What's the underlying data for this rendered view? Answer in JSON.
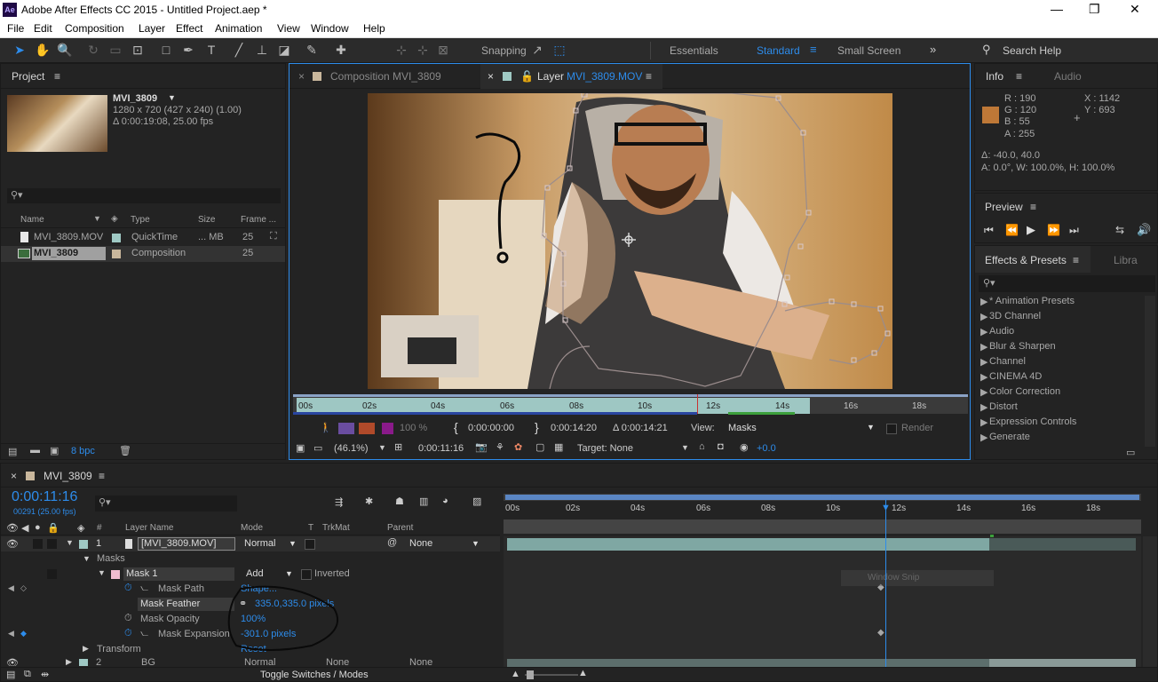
{
  "window": {
    "title": "Adobe After Effects CC 2015 - Untitled Project.aep *",
    "logo": "Ae",
    "minimize": "—",
    "maximize": "❐",
    "close": "✕"
  },
  "menu": [
    "File",
    "Edit",
    "Composition",
    "Layer",
    "Effect",
    "Animation",
    "View",
    "Window",
    "Help"
  ],
  "toolbar": {
    "snapping_label": "Snapping",
    "workspaces": [
      "Essentials",
      "Standard",
      "Small Screen"
    ],
    "active_workspace": "Standard",
    "search_help": "Search Help"
  },
  "project": {
    "tab": "Project",
    "item_name": "MVI_3809",
    "item_dims": "1280 x 720  (427 x 240) (1.00)",
    "item_duration": "Δ 0:00:19:08, 25.00 fps",
    "columns": [
      "Name",
      "Type",
      "Size",
      "Frame ..."
    ],
    "rows": [
      {
        "name": "MVI_3809.MOV",
        "type": "QuickTime",
        "size": "... MB",
        "frame": "25"
      },
      {
        "name": "MVI_3809",
        "type": "Composition",
        "size": "",
        "frame": "25"
      }
    ],
    "bpc": "8 bpc"
  },
  "viewer": {
    "tab_comp": "Composition MVI_3809",
    "tab_layer_prefix": "Layer",
    "tab_layer_name": "MVI_3809.MOV",
    "ruler": [
      "00s",
      "02s",
      "04s",
      "06s",
      "08s",
      "10s",
      "12s",
      "14s",
      "16s",
      "18s"
    ],
    "in_time": "0:00:00:00",
    "out_time": "0:00:14:20",
    "dur_time": "Δ 0:00:14:21",
    "view_label": "View:",
    "view_value": "Masks",
    "render_label": "Render",
    "zoom": "(46.1%)",
    "current_time": "0:00:11:16",
    "target": "Target: None",
    "exposure": "+0.0",
    "opacity_pct": "100 %"
  },
  "info": {
    "tab": "Info",
    "tab2": "Audio",
    "r": "R :  190",
    "g": "G :  120",
    "b": "B :  55",
    "a": "A :  255",
    "x": "X : 1142",
    "y": "Y : 693",
    "delta": "Δ: -40.0, 40.0",
    "line2": "A: 0.0°, W: 100.0%, H: 100.0%",
    "color_hex": "#be7837"
  },
  "preview": {
    "tab": "Preview"
  },
  "effects": {
    "tab": "Effects & Presets",
    "tab2": "Libra",
    "items": [
      "* Animation Presets",
      "3D Channel",
      "Audio",
      "Blur & Sharpen",
      "Channel",
      "CINEMA 4D",
      "Color Correction",
      "Distort",
      "Expression Controls",
      "Generate"
    ]
  },
  "timeline": {
    "tab": "MVI_3809",
    "timecode": "0:00:11:16",
    "frames": "00291 (25.00 fps)",
    "ruler": [
      "00s",
      "02s",
      "04s",
      "06s",
      "08s",
      "10s",
      "12s",
      "14s",
      "16s",
      "18s"
    ],
    "columns": {
      "num": "#",
      "layer": "Layer Name",
      "mode": "Mode",
      "t": "T",
      "trkmat": "TrkMat",
      "parent": "Parent"
    },
    "layer1": {
      "num": "1",
      "name": "[MVI_3809.MOV]",
      "mode": "Normal",
      "parent": "None"
    },
    "masks_label": "Masks",
    "mask1": {
      "name": "Mask 1",
      "mode": "Add",
      "inverted": "Inverted"
    },
    "props": [
      {
        "name": "Mask Path",
        "value": "Shape..."
      },
      {
        "name": "Mask Feather",
        "value": "335.0,335.0 pixels"
      },
      {
        "name": "Mask Opacity",
        "value": "100%"
      },
      {
        "name": "Mask Expansion",
        "value": "-301.0 pixels"
      }
    ],
    "transform": {
      "name": "Transform",
      "value": "Reset"
    },
    "layer2": {
      "num": "2",
      "name": "BG",
      "mode": "Normal",
      "trkmat": "None",
      "parent": "None"
    },
    "toggle": "Toggle Switches / Modes",
    "tooltip": "Window Snip"
  }
}
